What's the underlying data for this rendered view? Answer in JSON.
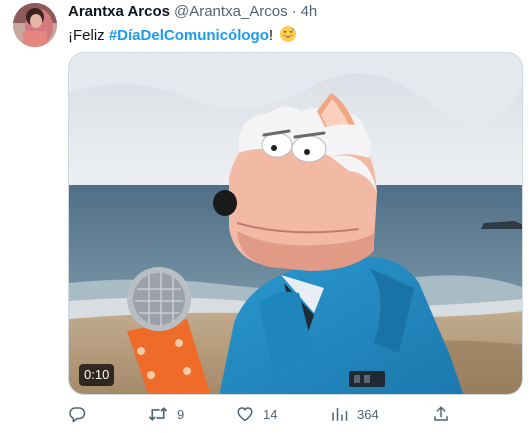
{
  "tweet": {
    "author_name": "Arantxa Arcos",
    "handle": "@Arantxa_Arcos",
    "separator": "·",
    "time": "4h",
    "text_prefix": "¡Feliz ",
    "hashtag": "#DíaDelComunicólogo",
    "text_suffix": "!",
    "emoji_icon": "grinning-sweat-emoji"
  },
  "media": {
    "duration": "0:10"
  },
  "actions": {
    "reply_icon": "reply-icon",
    "retweets": "9",
    "likes": "14",
    "views": "364",
    "share_icon": "share-icon"
  },
  "colors": {
    "text": "#0f1419",
    "secondary": "#536471",
    "link": "#1d9bf0"
  }
}
